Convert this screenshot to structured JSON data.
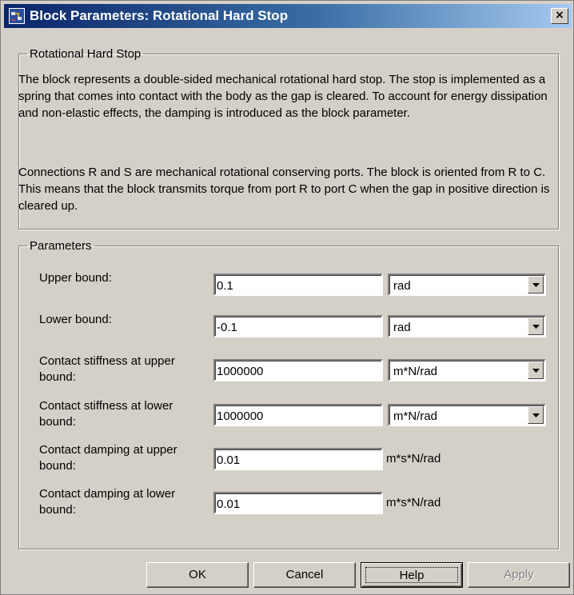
{
  "window": {
    "title": "Block Parameters: Rotational Hard Stop",
    "close_glyph": "×"
  },
  "description": {
    "group_title": "Rotational Hard Stop",
    "paragraph1": "The block represents a double-sided mechanical rotational hard stop. The stop is implemented as a spring that comes into contact with the body as the gap is cleared. To account for energy dissipation and non-elastic effects, the damping is introduced as the block parameter.",
    "paragraph2": "Connections R and S are mechanical rotational conserving ports. The block is oriented from R to C. This means that the block transmits torque from port R to port C when the gap in positive direction is cleared up."
  },
  "parameters": {
    "group_title": "Parameters",
    "rows": [
      {
        "label": "Upper bound:",
        "value": "0.1",
        "unit": "rad",
        "unit_type": "dropdown"
      },
      {
        "label": "Lower bound:",
        "value": "-0.1",
        "unit": "rad",
        "unit_type": "dropdown"
      },
      {
        "label": "Contact stiffness at upper bound:",
        "value": "1000000",
        "unit": "m*N/rad",
        "unit_type": "dropdown"
      },
      {
        "label": "Contact stiffness at lower bound:",
        "value": "1000000",
        "unit": "m*N/rad",
        "unit_type": "dropdown"
      },
      {
        "label": "Contact damping at upper bound:",
        "value": "0.01",
        "unit": "m*s*N/rad",
        "unit_type": "text"
      },
      {
        "label": "Contact damping at lower bound:",
        "value": "0.01",
        "unit": "m*s*N/rad",
        "unit_type": "text"
      }
    ]
  },
  "buttons": {
    "ok": "OK",
    "cancel": "Cancel",
    "help": "Help",
    "apply": "Apply"
  },
  "colors": {
    "title_bar_start": "#0a246a",
    "title_bar_end": "#a6caf0",
    "dialog_face": "#d4d0c8"
  },
  "icons": [
    "simulink-block-icon",
    "close-icon",
    "chevron-down-icon"
  ]
}
